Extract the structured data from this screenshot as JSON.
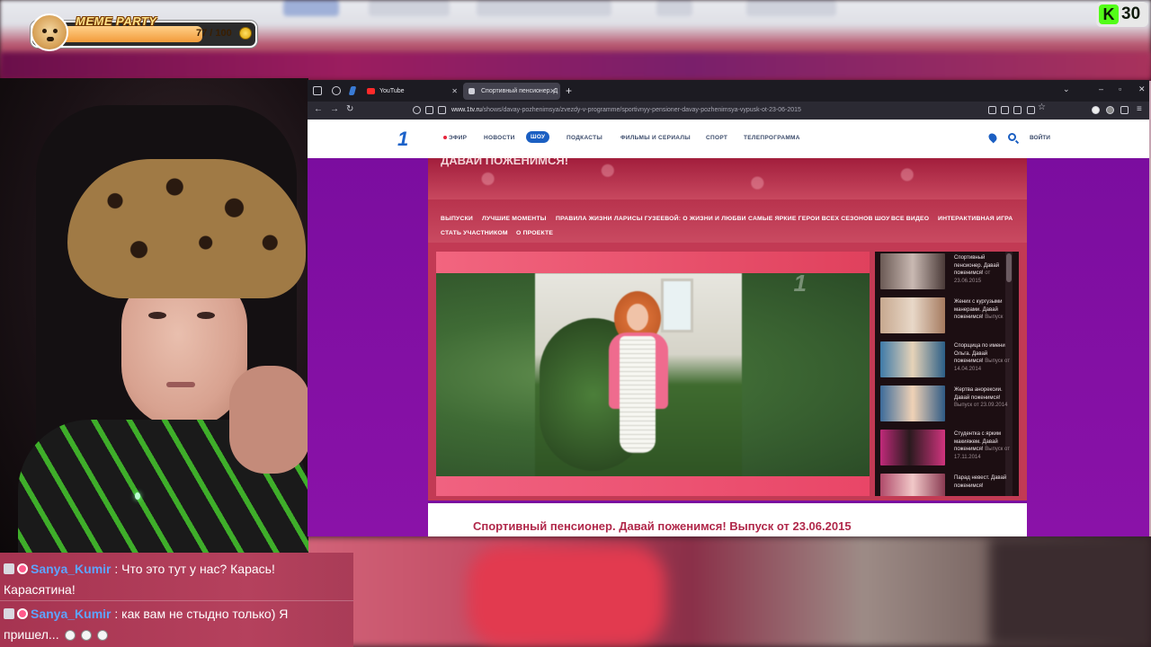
{
  "overlay": {
    "meme_party_title": "MEME PARTY",
    "meme_party_count": "77 / 100",
    "meme_party_progress": 0.77,
    "kick_logo": "K",
    "kick_viewers": "30"
  },
  "browser": {
    "tabs": [
      {
        "label": "YouTube",
        "icon": "youtube-icon",
        "active": false
      },
      {
        "label": "Спортивный пенсионер. Д",
        "icon": "speaker-icon",
        "active": true
      }
    ],
    "url_host": "www.1tv.ru",
    "url_path": "/shows/davay-pozhenimsya/zvezdy-v-programme/sportivnyy-pensioner-davay-pozhenimsya-vypusk-ot-23-06-2015"
  },
  "site": {
    "header_menu": [
      "ЭФИР",
      "НОВОСТИ",
      "ШОУ",
      "ПОДКАСТЫ",
      "ФИЛЬМЫ И СЕРИАЛЫ",
      "СПОРТ",
      "ТЕЛЕПРОГРАММА"
    ],
    "login_label": "ВОЙТИ",
    "show_title": "ДАВАЙ ПОЖЕНИМСЯ!",
    "subnav": [
      "ВЫПУСКИ",
      "ЛУЧШИЕ МОМЕНТЫ",
      "ПРАВИЛА ЖИЗНИ ЛАРИСЫ ГУЗЕЕВОЙ: О ЖИЗНИ И ЛЮБВИ",
      "САМЫЕ ЯРКИЕ ГЕРОИ ВСЕХ СЕЗОНОВ ШОУ",
      "ВСЕ ВИДЕО",
      "ИНТЕРАКТИВНАЯ ИГРА",
      "СТАТЬ УЧАСТНИКОМ",
      "О ПРОЕКТЕ"
    ],
    "playlist": [
      {
        "text": "Спортивный пенсионер. Давай поженимся!",
        "meta": "от 23.06.2015"
      },
      {
        "text": "Жених с кургузыми манерами. Давай поженимся!",
        "meta": "Выпуск"
      },
      {
        "text": "Спорщица по имени Ольга. Давай поженимся!",
        "meta": "Выпуск от 14.04.2014"
      },
      {
        "text": "Жертва анорексии. Давай поженимся!",
        "meta": "Выпуск от 23.09.2014"
      },
      {
        "text": "Студентка с ярким макияжем. Давай поженимся!",
        "meta": "Выпуск от 17.11.2014"
      },
      {
        "text": "Парад невест. Давай поженимся!",
        "meta": ""
      }
    ],
    "episode_title": "Спортивный пенсионер. Давай поженимся! Выпуск от 23.06.2015"
  },
  "chat": [
    {
      "user": "Sanya_Kumir",
      "message": ": Что это тут у нас? Карась!",
      "message_cont": "Карасятина!"
    },
    {
      "user": "Sanya_Kumir",
      "message": ": как вам не стыдно только) Я",
      "message_cont": "пришел..."
    }
  ]
}
